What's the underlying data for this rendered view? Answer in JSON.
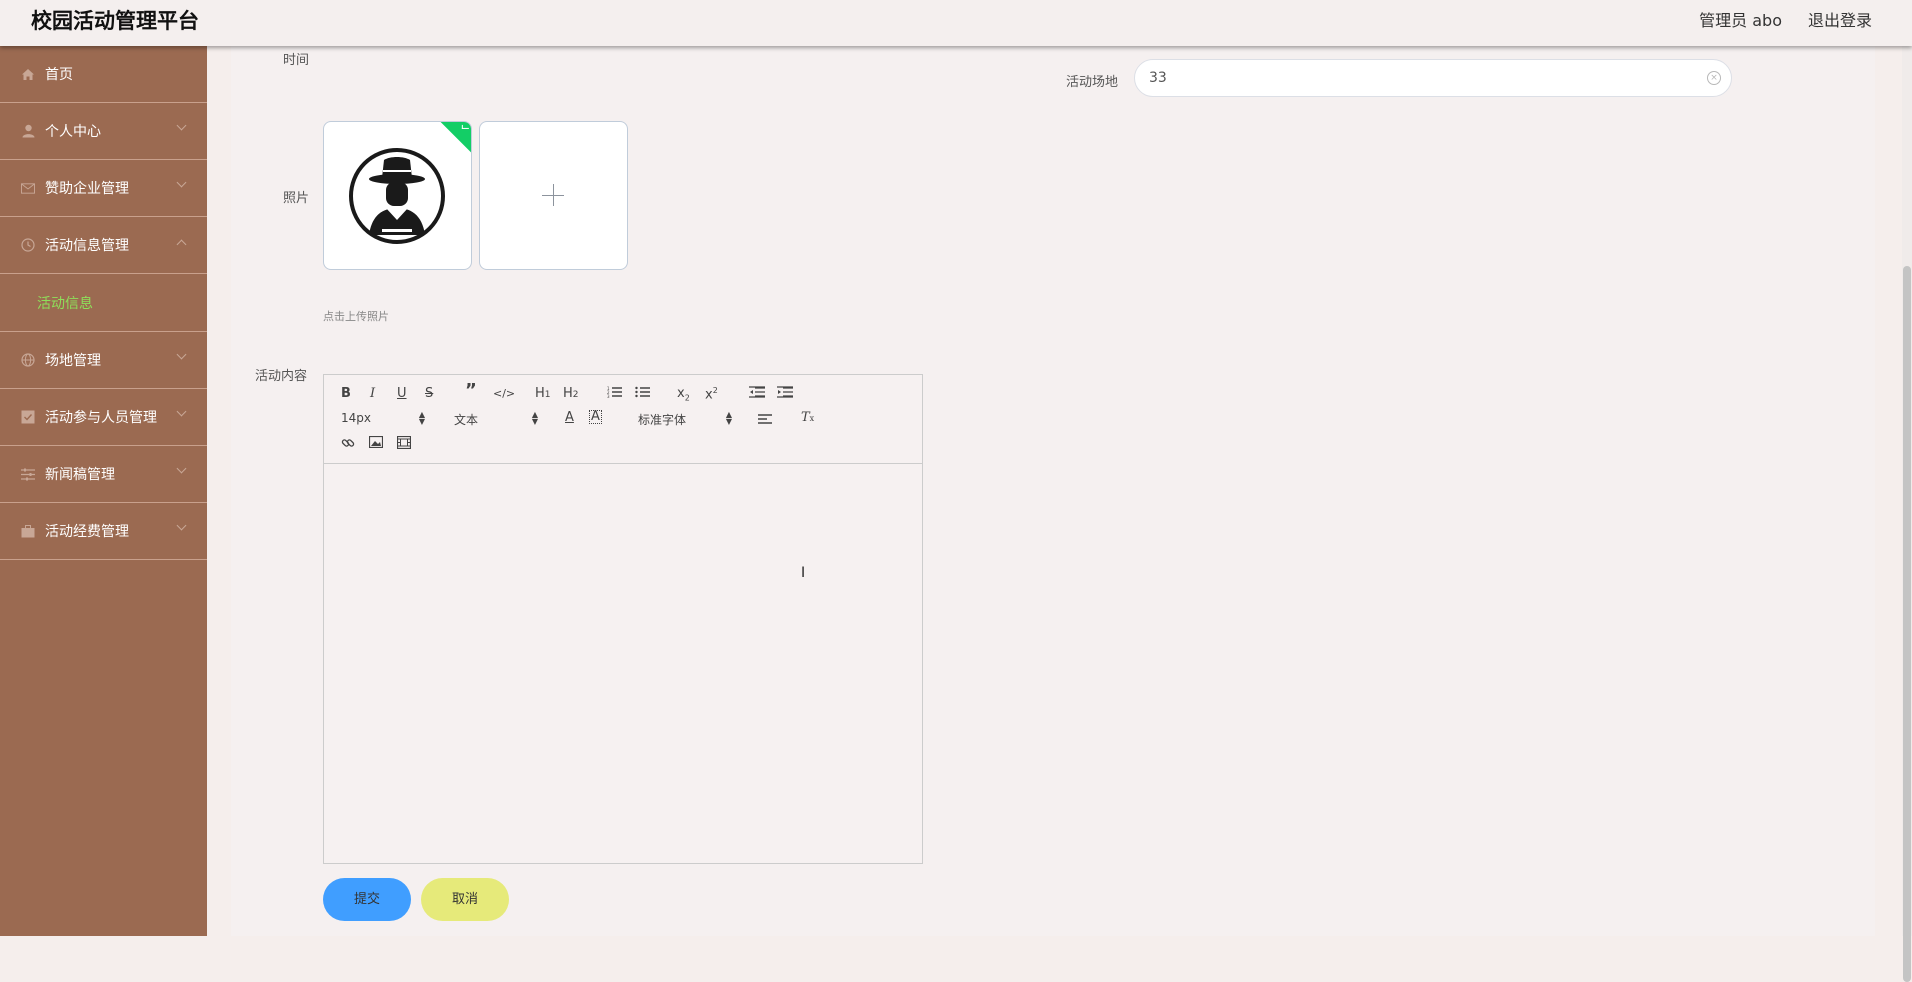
{
  "header": {
    "app_title": "校园活动管理平台",
    "user_label": "管理员 abo",
    "logout_label": "退出登录"
  },
  "sidebar": {
    "items": [
      {
        "label": "首页",
        "icon": "home-icon"
      },
      {
        "label": "个人中心",
        "icon": "user-icon"
      },
      {
        "label": "赞助企业管理",
        "icon": "mail-icon"
      },
      {
        "label": "活动信息管理",
        "icon": "clock-icon",
        "expanded": true,
        "children": [
          {
            "label": "活动信息",
            "active": true
          }
        ]
      },
      {
        "label": "场地管理",
        "icon": "globe-icon"
      },
      {
        "label": "活动参与人员管理",
        "icon": "checkbox-icon"
      },
      {
        "label": "新闻稿管理",
        "icon": "sliders-icon"
      },
      {
        "label": "活动经费管理",
        "icon": "briefcase-icon"
      }
    ],
    "accent_color": "#9b6a51",
    "active_color": "#8ee05a"
  },
  "form": {
    "time_label": "时间",
    "venue_label": "活动场地",
    "venue_value": "33",
    "photo_label": "照片",
    "photo_hint": "点击上传照片",
    "content_label": "活动内容"
  },
  "editor": {
    "font_size": "14px",
    "header_select": "文本",
    "font_family": "标准字体",
    "content": ""
  },
  "actions": {
    "submit_label": "提交",
    "cancel_label": "取消"
  }
}
